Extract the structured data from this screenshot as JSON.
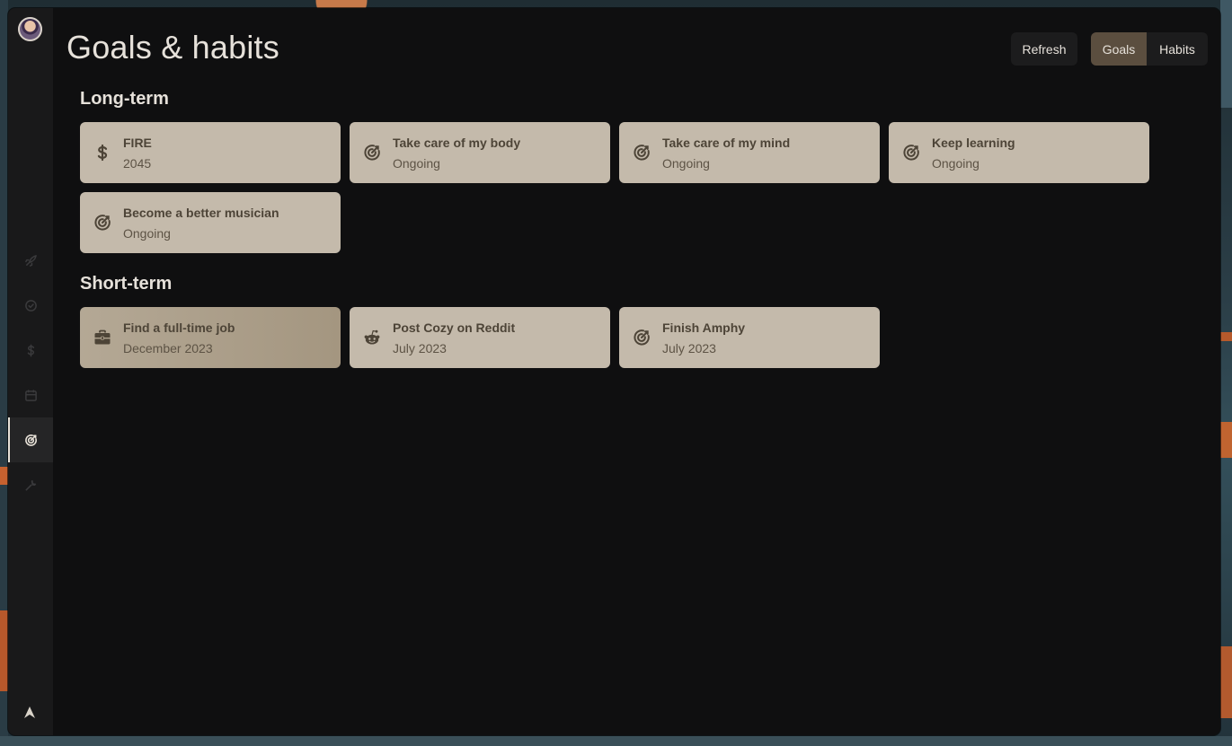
{
  "page": {
    "title": "Goals & habits"
  },
  "header": {
    "refresh_label": "Refresh",
    "view_toggle": {
      "options": [
        "Goals",
        "Habits"
      ],
      "selected": "Goals"
    }
  },
  "sidebar": {
    "items": [
      {
        "name": "launch",
        "icon": "rocket-icon"
      },
      {
        "name": "tasks",
        "icon": "check-circle-icon"
      },
      {
        "name": "finance",
        "icon": "dollar-icon"
      },
      {
        "name": "calendar",
        "icon": "calendar-icon"
      },
      {
        "name": "goals",
        "icon": "target-icon",
        "active": true
      },
      {
        "name": "tools",
        "icon": "wrench-icon"
      }
    ]
  },
  "sections": {
    "long_term": {
      "title": "Long-term",
      "goals": [
        {
          "title": "FIRE",
          "subtitle": "2045",
          "icon": "dollar-icon"
        },
        {
          "title": "Take care of my body",
          "subtitle": "Ongoing",
          "icon": "target-icon"
        },
        {
          "title": "Take care of my mind",
          "subtitle": "Ongoing",
          "icon": "target-icon"
        },
        {
          "title": "Keep learning",
          "subtitle": "Ongoing",
          "icon": "target-icon"
        },
        {
          "title": "Become a better musician",
          "subtitle": "Ongoing",
          "icon": "target-icon"
        }
      ]
    },
    "short_term": {
      "title": "Short-term",
      "goals": [
        {
          "title": "Find a full-time job",
          "subtitle": "December 2023",
          "icon": "briefcase-icon",
          "highlighted": true
        },
        {
          "title": "Post Cozy on Reddit",
          "subtitle": "July 2023",
          "icon": "reddit-icon"
        },
        {
          "title": "Finish Amphy",
          "subtitle": "July 2023",
          "icon": "target-icon"
        }
      ]
    }
  },
  "colors": {
    "window_bg": "#0f0f10",
    "sidebar_bg": "#19191a",
    "card_bg": "#c4baab",
    "card_text": "#4d4437",
    "accent_selected": "#5b4e3f",
    "heading_text": "#e6e1da"
  }
}
